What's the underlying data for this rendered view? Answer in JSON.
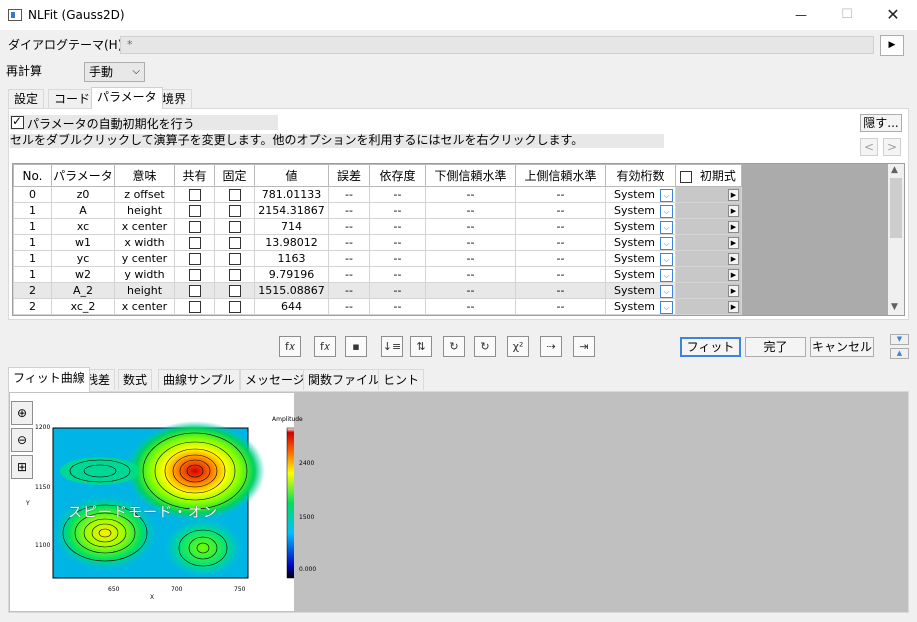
{
  "window": {
    "title": "NLFit (Gauss2D)",
    "minimize": "—",
    "maximize": "☐",
    "close": "✕"
  },
  "dialog_theme": {
    "label": "ダイアログテーマ(H)",
    "value": "*",
    "arrow": "▶"
  },
  "recalc": {
    "label": "再計算",
    "value": "手動"
  },
  "tabs": [
    {
      "label": "設定",
      "active": false
    },
    {
      "label": "コード",
      "active": false
    },
    {
      "label": "パラメータ",
      "active": true
    },
    {
      "label": "境界",
      "active": false
    }
  ],
  "auto_init": {
    "label": "パラメータの自動初期化を行う",
    "checked": true
  },
  "hint_text": "セルをダブルクリックして演算子を変更します。他のオプションを利用するにはセルを右クリックします。",
  "hide_button": "隠す...",
  "nav": {
    "prev": "<",
    "next": ">"
  },
  "table": {
    "headers": [
      "No.",
      "パラメータ",
      "意味",
      "共有",
      "固定",
      "値",
      "誤差",
      "依存度",
      "下側信頼水準",
      "上側信頼水準",
      "有効桁数",
      "初期式"
    ],
    "rows": [
      {
        "no": "0",
        "param": "z0",
        "meaning": "z offset",
        "value": "781.01133",
        "error": "--",
        "dep": "--",
        "lcl": "--",
        "ucl": "--",
        "sig": "System",
        "selected": false
      },
      {
        "no": "1",
        "param": "A",
        "meaning": "height",
        "value": "2154.31867",
        "error": "--",
        "dep": "--",
        "lcl": "--",
        "ucl": "--",
        "sig": "System",
        "selected": false
      },
      {
        "no": "1",
        "param": "xc",
        "meaning": "x center",
        "value": "714",
        "error": "--",
        "dep": "--",
        "lcl": "--",
        "ucl": "--",
        "sig": "System",
        "selected": false
      },
      {
        "no": "1",
        "param": "w1",
        "meaning": "x width",
        "value": "13.98012",
        "error": "--",
        "dep": "--",
        "lcl": "--",
        "ucl": "--",
        "sig": "System",
        "selected": false
      },
      {
        "no": "1",
        "param": "yc",
        "meaning": "y center",
        "value": "1163",
        "error": "--",
        "dep": "--",
        "lcl": "--",
        "ucl": "--",
        "sig": "System",
        "selected": false
      },
      {
        "no": "1",
        "param": "w2",
        "meaning": "y width",
        "value": "9.79196",
        "error": "--",
        "dep": "--",
        "lcl": "--",
        "ucl": "--",
        "sig": "System",
        "selected": false
      },
      {
        "no": "2",
        "param": "A_2",
        "meaning": "height",
        "value": "1515.08867",
        "error": "--",
        "dep": "--",
        "lcl": "--",
        "ucl": "--",
        "sig": "System",
        "selected": true
      },
      {
        "no": "2",
        "param": "xc_2",
        "meaning": "x center",
        "value": "644",
        "error": "--",
        "dep": "--",
        "lcl": "--",
        "ucl": "--",
        "sig": "System",
        "selected": false
      }
    ]
  },
  "toolbar_icons": [
    "edit-function-icon",
    "function-file-icon",
    "save-icon",
    "sort-icon",
    "sort-alt-icon",
    "one-iteration-icon",
    "iterations-icon",
    "chi-square-icon",
    "iterate-until-icon",
    "fit-until-converged-icon"
  ],
  "toolbar_glyphs": [
    "f𝑥",
    "f𝑥",
    "▪",
    "↓≡",
    "⇅",
    "↻",
    "↻",
    "χ²",
    "⇢",
    "⇥"
  ],
  "buttons": {
    "fit": "フィット",
    "done": "完了",
    "cancel": "キャンセル"
  },
  "lower_tabs": [
    {
      "label": "フィット曲線",
      "active": true
    },
    {
      "label": "残差",
      "active": false
    },
    {
      "label": "数式",
      "active": false
    },
    {
      "label": "曲線サンプル",
      "active": false
    },
    {
      "label": "メッセージ",
      "active": false
    },
    {
      "label": "関数ファイル",
      "active": false
    },
    {
      "label": "ヒント",
      "active": false
    }
  ],
  "preview": {
    "overlay_text": "スピードモード・オン",
    "legend_title": "Amplitude",
    "x_label": "X",
    "y_label": "Y",
    "x_ticks": [
      "650",
      "700",
      "750"
    ],
    "y_ticks": [
      "1200",
      "1150",
      "1100"
    ],
    "legend_ticks": [
      "2400",
      "1500",
      "0.000"
    ]
  },
  "colors": {
    "accent": "#3b86d8",
    "selected_row": "#e8e8e8",
    "panel_gray": "#c0c0c0"
  }
}
